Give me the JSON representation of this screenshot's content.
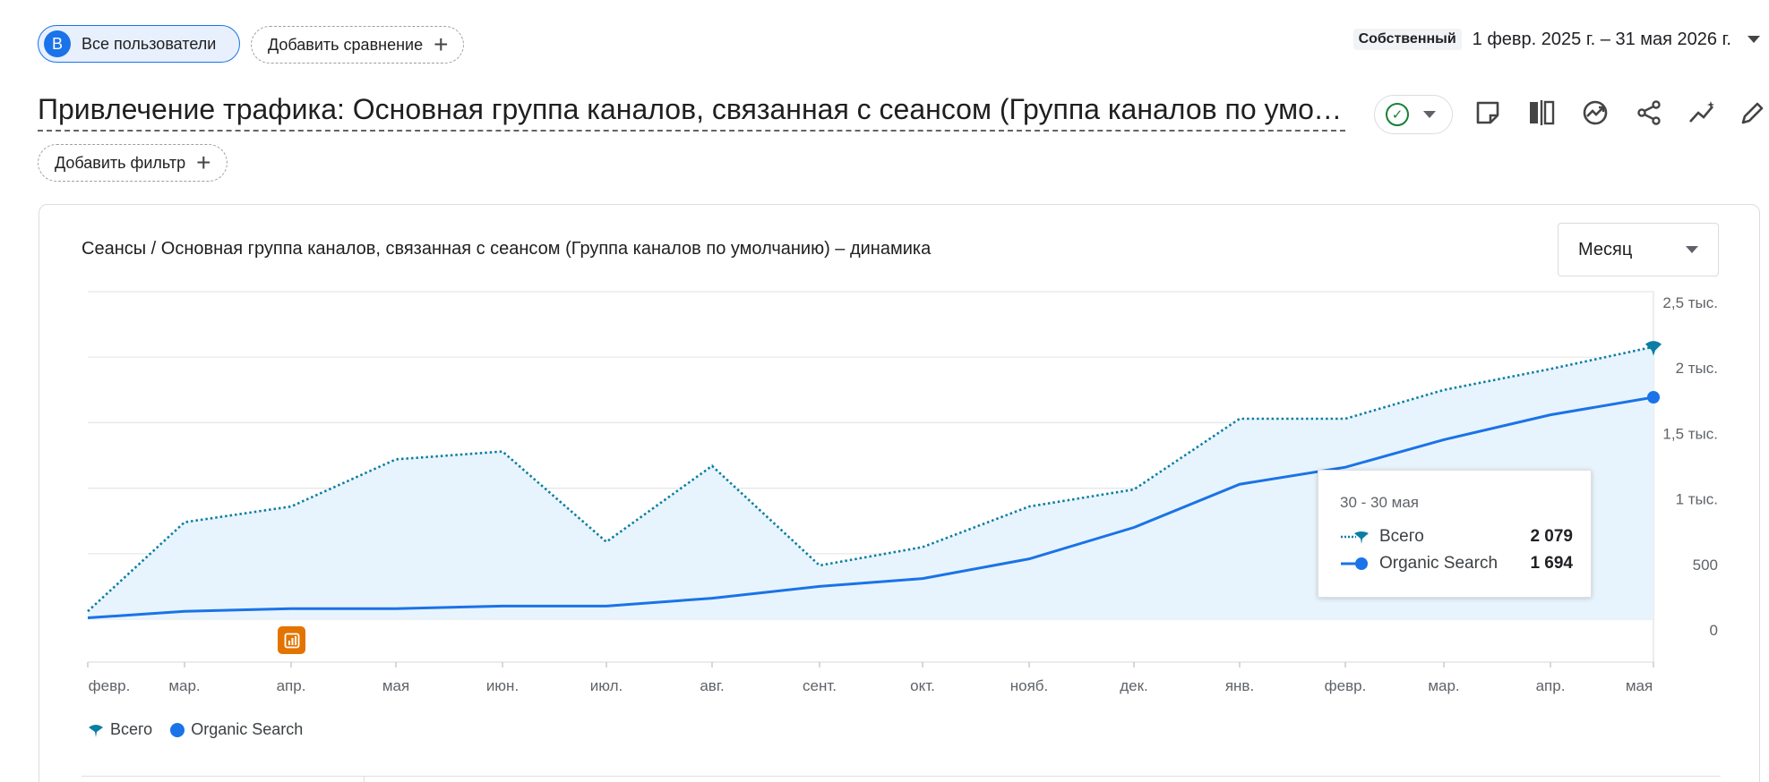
{
  "top": {
    "segment_avatar": "В",
    "segment_label": "Все пользователи",
    "add_comparison": "Добавить сравнение",
    "date_badge": "Собственный",
    "date_range": "1 февр. 2025 г. – 31 мая 2026 г."
  },
  "report": {
    "title": "Привлечение трафика: Основная группа каналов, связанная с сеансом (Группа каналов по умолчанию)",
    "add_filter": "Добавить фильтр"
  },
  "toolbar": {
    "icons": [
      "notes-icon",
      "compare-columns-icon",
      "insights-icon",
      "share-icon",
      "trend-icon",
      "edit-icon"
    ]
  },
  "card": {
    "title": "Сеансы / Основная группа каналов, связанная с сеансом (Группа каналов по умолчанию) – динамика",
    "period_select": "Месяц"
  },
  "chart_data": {
    "type": "line",
    "x": [
      "февр.",
      "мар.",
      "апр.",
      "мая",
      "июн.",
      "июл.",
      "авг.",
      "сент.",
      "окт.",
      "нояб.",
      "дек.",
      "янв.",
      "февр.",
      "мар.",
      "апр.",
      "мая"
    ],
    "series": [
      {
        "name": "Всего",
        "style": "dotted",
        "color": "#0a7ea4",
        "values": [
          60,
          740,
          860,
          1220,
          1280,
          590,
          1170,
          410,
          550,
          860,
          990,
          1530,
          1530,
          1750,
          1910,
          2079
        ]
      },
      {
        "name": "Organic Search",
        "style": "solid",
        "color": "#1a73e8",
        "values": [
          10,
          60,
          80,
          80,
          100,
          100,
          160,
          250,
          310,
          460,
          700,
          1030,
          1160,
          1370,
          1560,
          1694
        ]
      }
    ],
    "y_ticks": [
      "0",
      "500",
      "1 тыс.",
      "1,5 тыс.",
      "2 тыс.",
      "2,5 тыс."
    ],
    "ylim": [
      0,
      2500
    ],
    "grid": true,
    "legend_position": "bottom-left"
  },
  "tooltip": {
    "date": "30 - 30 мая",
    "rows": [
      {
        "name": "Всего",
        "value": "2 079"
      },
      {
        "name": "Organic Search",
        "value": "1 694"
      }
    ]
  },
  "legend": {
    "items": [
      "Всего",
      "Organic Search"
    ]
  },
  "colors": {
    "accent": "#1a73e8",
    "total_series": "#0a7ea4",
    "area_fill": "#e8f4fd",
    "annotation": "#e37400"
  }
}
